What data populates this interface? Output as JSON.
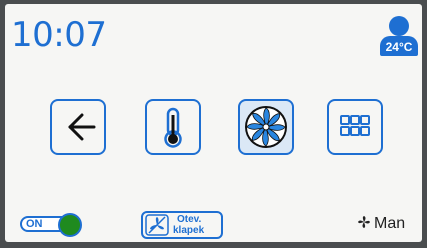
{
  "header": {
    "time": "10:07",
    "temperature": "24°C",
    "user_icon": "user-temperature-icon"
  },
  "menu": [
    {
      "name": "back",
      "icon": "arrow-left-icon"
    },
    {
      "name": "temperature",
      "icon": "thermometer-icon"
    },
    {
      "name": "fan",
      "icon": "fan-icon",
      "active": true
    },
    {
      "name": "menu",
      "icon": "grid-icon"
    }
  ],
  "footer": {
    "toggle_label": "ON",
    "toggle_state": true,
    "flap_line1": "Otev.",
    "flap_line2": "klapek",
    "mode_label": "Man"
  },
  "colors": {
    "accent": "#1e6fd2",
    "toggle_knob": "#1f8a1f",
    "background": "#f6f6f4"
  }
}
